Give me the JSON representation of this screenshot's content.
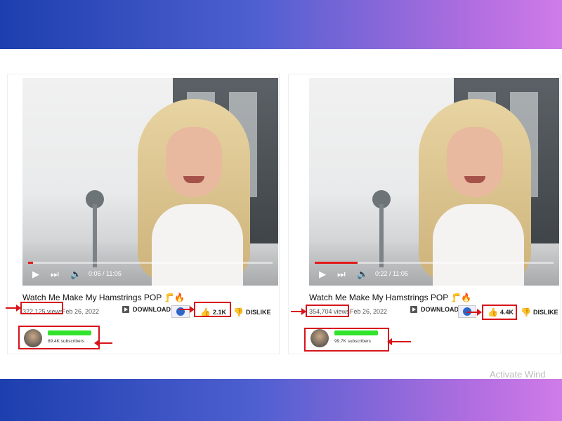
{
  "watermark": "Activate Wind",
  "colors": {
    "accent_red": "#d7141b",
    "redacted_name": "#32e32b",
    "progress_red": "#e21b1b"
  },
  "panels": [
    {
      "video": {
        "time": "0:05 / 11:05",
        "progress": 0.02
      },
      "title": "Watch Me Make My Hamstrings POP 🦵🔥",
      "views": "322,125 views",
      "date": "Feb 26, 2022",
      "download_label": "DOWNLOAD",
      "likes": "2.1K",
      "dislike_label": "DISLIKE",
      "subscribers": "89.4K subscribers"
    },
    {
      "video": {
        "time": "0:22 / 11:05",
        "progress": 0.18
      },
      "title": "Watch Me Make My Hamstrings POP 🦵🔥",
      "views": "354,704 views",
      "date": "Feb 26, 2022",
      "download_label": "DOWNLOAD",
      "likes": "4.4K",
      "dislike_label": "DISLIKE",
      "subscribers": "99.7K subscribers"
    }
  ],
  "icons": [
    "play-icon",
    "next-icon",
    "volume-icon",
    "download-icon",
    "thumbs-up-icon",
    "thumbs-down-icon",
    "avatar-icon"
  ]
}
